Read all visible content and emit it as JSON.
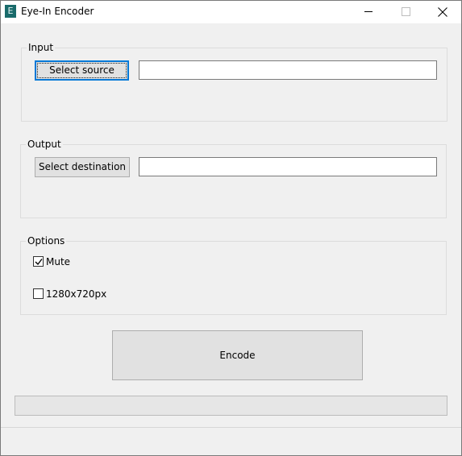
{
  "window": {
    "title": "Eye-In Encoder",
    "icon_letter": "E",
    "icon": "app-e-icon"
  },
  "input_group": {
    "label": "Input",
    "select_button": "Select source",
    "path_value": ""
  },
  "output_group": {
    "label": "Output",
    "select_button": "Select destination",
    "path_value": ""
  },
  "options_group": {
    "label": "Options",
    "mute_label": "Mute",
    "mute_checked": true,
    "resolution_label": "1280x720px",
    "resolution_checked": false
  },
  "actions": {
    "encode_label": "Encode"
  },
  "progress": {
    "fraction": 0
  },
  "colors": {
    "focus_accent": "#0078d7",
    "icon_bg": "#1a6b6b",
    "progress_fill": "#06b025"
  }
}
